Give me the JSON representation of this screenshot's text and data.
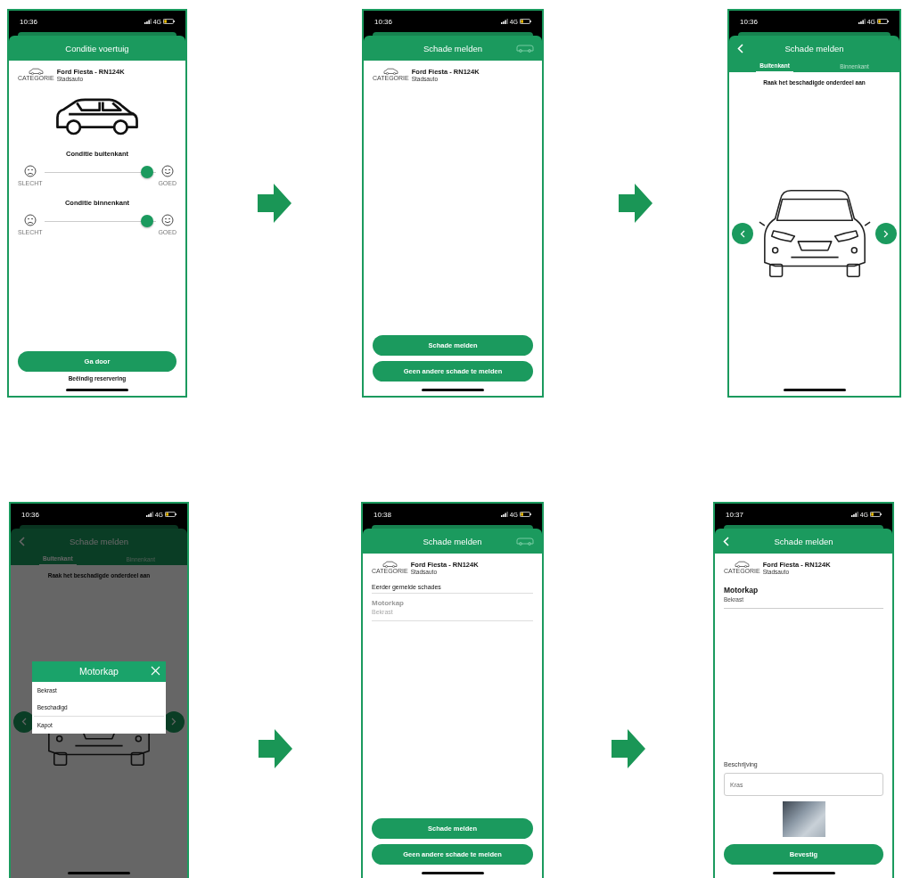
{
  "screens": [
    {
      "kind": "condition",
      "status": {
        "time": "10:36",
        "network": "4G"
      },
      "header": {
        "title": "Conditie voertuig",
        "back": false,
        "car_icon": false
      },
      "vehicle": {
        "name": "Ford Fiesta - RN124K",
        "category_label": "CATEGORIE",
        "category": "Stadsauto"
      },
      "sliders": [
        {
          "title": "Conditie buitenkant",
          "low_label": "SLECHT",
          "high_label": "GOED",
          "level": 0.97
        },
        {
          "title": "Conditie binnenkant",
          "low_label": "SLECHT",
          "high_label": "GOED",
          "level": 0.97
        }
      ],
      "buttons": [
        "Ga door"
      ],
      "link": "Beëindig reservering"
    },
    {
      "kind": "report",
      "status": {
        "time": "10:36",
        "network": "4G"
      },
      "header": {
        "title": "Schade melden",
        "back": false,
        "car_icon": true
      },
      "vehicle": {
        "name": "Ford Fiesta - RN124K",
        "category_label": "CATEGORIE",
        "category": "Stadsauto"
      },
      "buttons": [
        "Schade melden",
        "Geen andere schade te melden"
      ]
    },
    {
      "kind": "diagram",
      "status": {
        "time": "10:36",
        "network": "4G"
      },
      "header": {
        "title": "Schade melden",
        "back": true,
        "car_icon": false,
        "tabs": [
          {
            "label": "Buitenkant",
            "selected": true
          },
          {
            "label": "Binnenkant",
            "selected": false
          }
        ]
      },
      "instruction": "Raak het beschadigde onderdeel aan"
    },
    {
      "kind": "diagram",
      "status": {
        "time": "10:36",
        "network": "4G"
      },
      "header": {
        "title": "Schade melden",
        "back": true,
        "car_icon": false,
        "tabs": [
          {
            "label": "Buitenkant",
            "selected": true
          },
          {
            "label": "Binnenkant",
            "selected": false
          }
        ]
      },
      "instruction": "Raak het beschadigde onderdeel aan",
      "dialog": {
        "title": "Motorkap",
        "options": [
          "Bekrast",
          "Beschadigd",
          "Kapot"
        ]
      }
    },
    {
      "kind": "report",
      "status": {
        "time": "10:38",
        "network": "4G"
      },
      "header": {
        "title": "Schade melden",
        "back": false,
        "car_icon": true
      },
      "vehicle": {
        "name": "Ford Fiesta - RN124K",
        "category_label": "CATEGORIE",
        "category": "Stadsauto"
      },
      "previous": {
        "label": "Eerder gemelde schades",
        "items": [
          {
            "part": "Motorkap",
            "damage": "Bekrast"
          }
        ]
      },
      "buttons": [
        "Schade melden",
        "Geen andere schade te melden"
      ]
    },
    {
      "kind": "detail",
      "status": {
        "time": "10:37",
        "network": "4G"
      },
      "header": {
        "title": "Schade melden",
        "back": true,
        "car_icon": false
      },
      "vehicle": {
        "name": "Ford Fiesta - RN124K",
        "category_label": "CATEGORIE",
        "category": "Stadsauto"
      },
      "part": "Motorkap",
      "damage": "Bekrast",
      "description": {
        "label": "Beschrijving",
        "value": "Kras"
      },
      "buttons": [
        "Bevestig"
      ]
    }
  ]
}
